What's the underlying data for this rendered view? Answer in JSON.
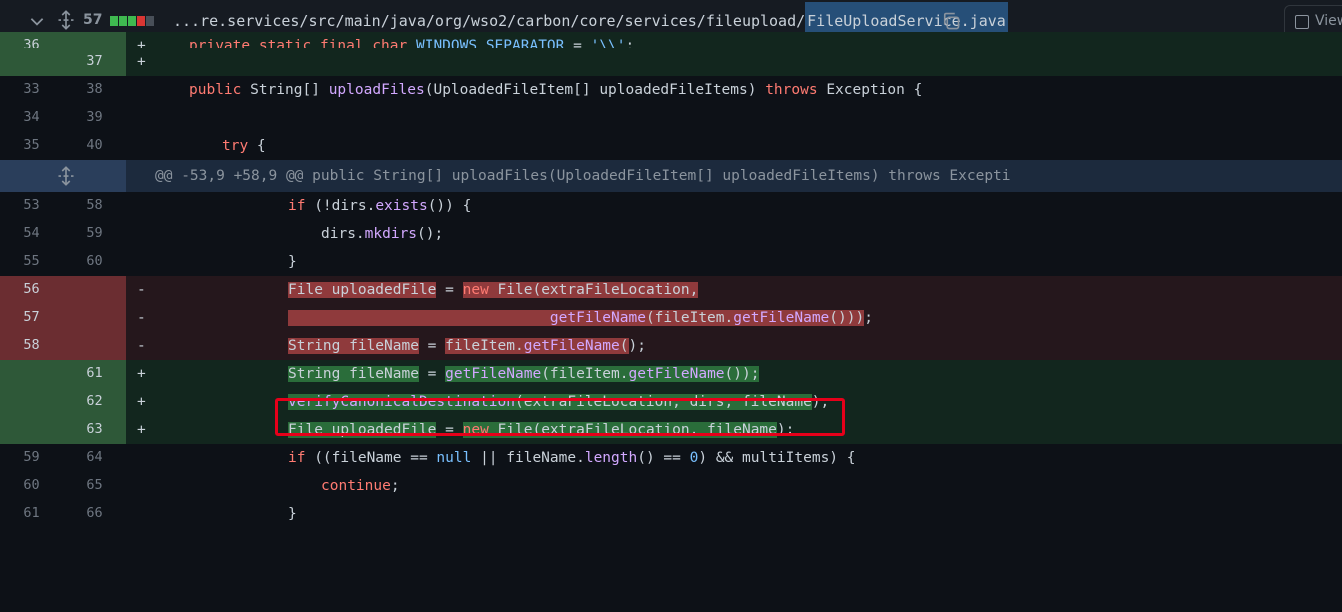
{
  "header": {
    "changes_count": "57",
    "path_prefix": "...re.services/src/main/java/org/wso2/carbon/core/services/fileupload/",
    "file_name": "FileUploadService.java",
    "viewed_label": "View",
    "diffstat_colors": [
      "#3fb950",
      "#3fb950",
      "#3fb950",
      "#da3633",
      "#484f58"
    ]
  },
  "icons": {
    "collapse": "chevron-down-icon",
    "expand": "unfold-icon",
    "copy": "copy-icon"
  },
  "hunk": {
    "header": "@@ -53,9 +58,9 @@ public String[] uploadFiles(UploadedFileItem[] uploadedFileItems) throws Excepti"
  },
  "lines": [
    {
      "old": "36",
      "new": "",
      "mark": "+",
      "code": "private static final char WINDOWS_SEPARATOR = '\\\\';"
    },
    {
      "old": "",
      "new": "37",
      "mark": "+",
      "code": ""
    },
    {
      "old": "33",
      "new": "38",
      "mark": "",
      "code": "public String[] uploadFiles(UploadedFileItem[] uploadedFileItems) throws Exception {"
    },
    {
      "old": "34",
      "new": "39",
      "mark": "",
      "code": ""
    },
    {
      "old": "35",
      "new": "40",
      "mark": "",
      "code": "try {"
    },
    {
      "old": "53",
      "new": "58",
      "mark": "",
      "code": "if (!dirs.exists()) {"
    },
    {
      "old": "54",
      "new": "59",
      "mark": "",
      "code": "dirs.mkdirs();"
    },
    {
      "old": "55",
      "new": "60",
      "mark": "",
      "code": "}"
    },
    {
      "old": "56",
      "new": "",
      "mark": "-",
      "code": "File uploadedFile = new File(extraFileLocation,"
    },
    {
      "old": "57",
      "new": "",
      "mark": "-",
      "code": "getFileName(fileItem.getFileName()));"
    },
    {
      "old": "58",
      "new": "",
      "mark": "-",
      "code": "String fileName = fileItem.getFileName();"
    },
    {
      "old": "",
      "new": "61",
      "mark": "+",
      "code": "String fileName = getFileName(fileItem.getFileName());"
    },
    {
      "old": "",
      "new": "62",
      "mark": "+",
      "code": "verifyCanonicalDestination(extraFileLocation, dirs, fileName);"
    },
    {
      "old": "",
      "new": "63",
      "mark": "+",
      "code": "File uploadedFile = new File(extraFileLocation, fileName);"
    },
    {
      "old": "59",
      "new": "64",
      "mark": "",
      "code": "if ((fileName == null || fileName.length() == 0) && multiItems) {"
    },
    {
      "old": "60",
      "new": "65",
      "mark": "",
      "code": "continue;"
    },
    {
      "old": "61",
      "new": "66",
      "mark": "",
      "code": "}"
    }
  ]
}
